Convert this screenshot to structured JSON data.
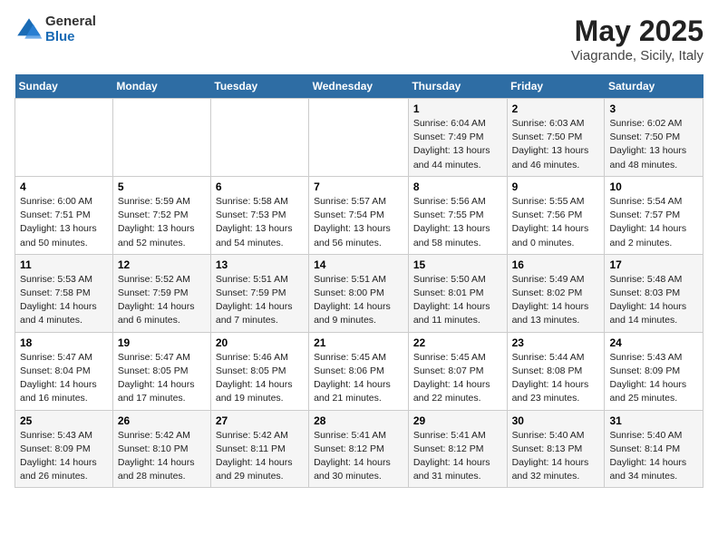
{
  "header": {
    "logo_general": "General",
    "logo_blue": "Blue",
    "month_title": "May 2025",
    "location": "Viagrande, Sicily, Italy"
  },
  "days_of_week": [
    "Sunday",
    "Monday",
    "Tuesday",
    "Wednesday",
    "Thursday",
    "Friday",
    "Saturday"
  ],
  "weeks": [
    [
      {
        "day": "",
        "info": ""
      },
      {
        "day": "",
        "info": ""
      },
      {
        "day": "",
        "info": ""
      },
      {
        "day": "",
        "info": ""
      },
      {
        "day": "1",
        "info": "Sunrise: 6:04 AM\nSunset: 7:49 PM\nDaylight: 13 hours\nand 44 minutes."
      },
      {
        "day": "2",
        "info": "Sunrise: 6:03 AM\nSunset: 7:50 PM\nDaylight: 13 hours\nand 46 minutes."
      },
      {
        "day": "3",
        "info": "Sunrise: 6:02 AM\nSunset: 7:50 PM\nDaylight: 13 hours\nand 48 minutes."
      }
    ],
    [
      {
        "day": "4",
        "info": "Sunrise: 6:00 AM\nSunset: 7:51 PM\nDaylight: 13 hours\nand 50 minutes."
      },
      {
        "day": "5",
        "info": "Sunrise: 5:59 AM\nSunset: 7:52 PM\nDaylight: 13 hours\nand 52 minutes."
      },
      {
        "day": "6",
        "info": "Sunrise: 5:58 AM\nSunset: 7:53 PM\nDaylight: 13 hours\nand 54 minutes."
      },
      {
        "day": "7",
        "info": "Sunrise: 5:57 AM\nSunset: 7:54 PM\nDaylight: 13 hours\nand 56 minutes."
      },
      {
        "day": "8",
        "info": "Sunrise: 5:56 AM\nSunset: 7:55 PM\nDaylight: 13 hours\nand 58 minutes."
      },
      {
        "day": "9",
        "info": "Sunrise: 5:55 AM\nSunset: 7:56 PM\nDaylight: 14 hours\nand 0 minutes."
      },
      {
        "day": "10",
        "info": "Sunrise: 5:54 AM\nSunset: 7:57 PM\nDaylight: 14 hours\nand 2 minutes."
      }
    ],
    [
      {
        "day": "11",
        "info": "Sunrise: 5:53 AM\nSunset: 7:58 PM\nDaylight: 14 hours\nand 4 minutes."
      },
      {
        "day": "12",
        "info": "Sunrise: 5:52 AM\nSunset: 7:59 PM\nDaylight: 14 hours\nand 6 minutes."
      },
      {
        "day": "13",
        "info": "Sunrise: 5:51 AM\nSunset: 7:59 PM\nDaylight: 14 hours\nand 7 minutes."
      },
      {
        "day": "14",
        "info": "Sunrise: 5:51 AM\nSunset: 8:00 PM\nDaylight: 14 hours\nand 9 minutes."
      },
      {
        "day": "15",
        "info": "Sunrise: 5:50 AM\nSunset: 8:01 PM\nDaylight: 14 hours\nand 11 minutes."
      },
      {
        "day": "16",
        "info": "Sunrise: 5:49 AM\nSunset: 8:02 PM\nDaylight: 14 hours\nand 13 minutes."
      },
      {
        "day": "17",
        "info": "Sunrise: 5:48 AM\nSunset: 8:03 PM\nDaylight: 14 hours\nand 14 minutes."
      }
    ],
    [
      {
        "day": "18",
        "info": "Sunrise: 5:47 AM\nSunset: 8:04 PM\nDaylight: 14 hours\nand 16 minutes."
      },
      {
        "day": "19",
        "info": "Sunrise: 5:47 AM\nSunset: 8:05 PM\nDaylight: 14 hours\nand 17 minutes."
      },
      {
        "day": "20",
        "info": "Sunrise: 5:46 AM\nSunset: 8:05 PM\nDaylight: 14 hours\nand 19 minutes."
      },
      {
        "day": "21",
        "info": "Sunrise: 5:45 AM\nSunset: 8:06 PM\nDaylight: 14 hours\nand 21 minutes."
      },
      {
        "day": "22",
        "info": "Sunrise: 5:45 AM\nSunset: 8:07 PM\nDaylight: 14 hours\nand 22 minutes."
      },
      {
        "day": "23",
        "info": "Sunrise: 5:44 AM\nSunset: 8:08 PM\nDaylight: 14 hours\nand 23 minutes."
      },
      {
        "day": "24",
        "info": "Sunrise: 5:43 AM\nSunset: 8:09 PM\nDaylight: 14 hours\nand 25 minutes."
      }
    ],
    [
      {
        "day": "25",
        "info": "Sunrise: 5:43 AM\nSunset: 8:09 PM\nDaylight: 14 hours\nand 26 minutes."
      },
      {
        "day": "26",
        "info": "Sunrise: 5:42 AM\nSunset: 8:10 PM\nDaylight: 14 hours\nand 28 minutes."
      },
      {
        "day": "27",
        "info": "Sunrise: 5:42 AM\nSunset: 8:11 PM\nDaylight: 14 hours\nand 29 minutes."
      },
      {
        "day": "28",
        "info": "Sunrise: 5:41 AM\nSunset: 8:12 PM\nDaylight: 14 hours\nand 30 minutes."
      },
      {
        "day": "29",
        "info": "Sunrise: 5:41 AM\nSunset: 8:12 PM\nDaylight: 14 hours\nand 31 minutes."
      },
      {
        "day": "30",
        "info": "Sunrise: 5:40 AM\nSunset: 8:13 PM\nDaylight: 14 hours\nand 32 minutes."
      },
      {
        "day": "31",
        "info": "Sunrise: 5:40 AM\nSunset: 8:14 PM\nDaylight: 14 hours\nand 34 minutes."
      }
    ]
  ]
}
